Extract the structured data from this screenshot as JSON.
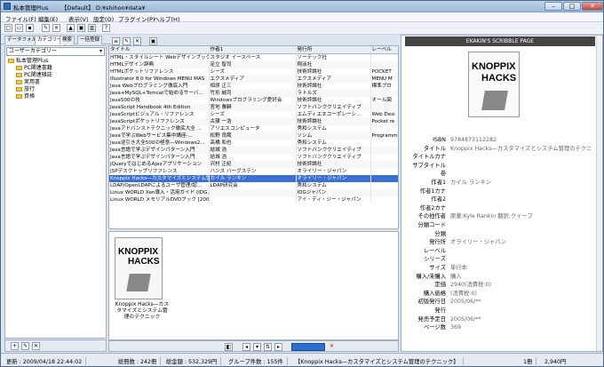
{
  "window": {
    "title": "私本管理Plus",
    "doc": "【Default】 D:¥shihon¥data¥",
    "min": "–",
    "max": "□",
    "close": "✕"
  },
  "menu": [
    "ファイル(F)",
    "編集(E)",
    "表示(V)",
    "設定(O)",
    "プラグイン(P)",
    "ヘルプ(H)"
  ],
  "tabs": [
    "データフォルダ",
    "カテゴリー",
    "検索",
    "一括登録"
  ],
  "category_select": "ユーザーカテゴリー",
  "tree": [
    "私本管理Plus",
    "PC関連書籍",
    "PC関連雑誌",
    "実用書",
    "旅行",
    "資格"
  ],
  "grid": {
    "columns": [
      "タイトル",
      "作者1",
      "発行所",
      "レーベル"
    ],
    "rows": [
      [
        "HTML・スタイルシート Webデザインブック",
        "スタジオ イースペース",
        "ソーテック社",
        ""
      ],
      [
        "HTMLデザイン辞典",
        "足立 智司",
        "翔泳社",
        ""
      ],
      [
        "HTMLポケットリファレンス",
        "シーズ",
        "技術評論社",
        "POCKET"
      ],
      [
        "Illustrator 8.0 for Windows MENU MAS",
        "エクスメディア",
        "エクスメディア",
        "MENU M"
      ],
      [
        "Java Webプログラミング徹底入門",
        "相原 正三",
        "技術評論社",
        "標準プロ"
      ],
      [
        "Java+MySQL+Tomcatで始めるサーバ...",
        "竹形 誠司",
        "ラトルズ",
        ""
      ],
      [
        "Java500の技",
        "Windowsプログラミング愛好会",
        "技術評論社",
        "オール図"
      ],
      [
        "JavaScript Handbook 4th Edition",
        "宮地 雅嗣",
        "ソフトバンククリエイティブ",
        ""
      ],
      [
        "JavaScriptビジュアル・リファレンス",
        "シーズ",
        "エムディエヌコーポレーシ...",
        "Web Desi"
      ],
      [
        "JavaScriptポケットリファレンス",
        "古籏 一浩",
        "技術評論社",
        "Pocket re"
      ],
      [
        "Javaアドバンストテクニック徹底大全 ...",
        "アリエスコンピュータ",
        "秀和システム",
        ""
      ],
      [
        "Javaで学ぶWebサービス集中講座-...",
        "松野 良蔵",
        "ソシム",
        "Programm"
      ],
      [
        "Java逆引き大全500の極意―Windows2...",
        "高橋 和也",
        "秀和システム",
        ""
      ],
      [
        "Java言語で学ぶデザインパターン入門",
        "結城 浩",
        "ソフトバンククリエイティブ",
        ""
      ],
      [
        "Java言語で学ぶデザインパターン入門",
        "結城 浩",
        "ソフトバンククリエイティブ",
        ""
      ],
      [
        "jQueryではじめるAjaxアプリケーション",
        "沢村 正紀",
        "技術評論社",
        ""
      ],
      [
        "JSPデスクトップリファレンス",
        "ハンス バーグステン",
        "オライリー・ジャパン",
        ""
      ],
      [
        "Knoppix Hacks―カスタマイズとシステム管理のテクニック",
        "カイル ランキン",
        "オライリー・ジャパン",
        ""
      ],
      [
        "LDAP/OpenLDAPによるユーザ管理/認...",
        "LDAP研究会",
        "秀和システム",
        ""
      ],
      [
        "Linux WORLD Xen導入・活用ガイド (IDG...",
        "",
        "IDGジャパン",
        ""
      ],
      [
        "Linux WORLD メモリアルDVDブック [2001-...",
        "",
        "アイ・ディ・ジー・ジャパン",
        ""
      ]
    ],
    "selected_index": 17
  },
  "thumb": {
    "cover_title": "KNOPPIX",
    "cover_sub": "HACKS",
    "caption": "Knoppix Hacks―カスタマイズとシステム管理のテクニック"
  },
  "detail": {
    "header": "EKAKIN'S SCRIBBLE PAGE",
    "cover_title": "KNOPPIX",
    "cover_sub": "HACKS",
    "fields": [
      [
        "ISBN",
        "9784873112282"
      ],
      [
        "タイトル",
        "Knoppix Hacks―カスタマイズとシステム管理のテクニック"
      ],
      [
        "タイトルカナ",
        ""
      ],
      [
        "サブタイトル",
        ""
      ],
      [
        "巻",
        ""
      ],
      [
        "作者1",
        "カイル ランキン"
      ],
      [
        "作者1カナ",
        ""
      ],
      [
        "作者2",
        ""
      ],
      [
        "作者2カナ",
        ""
      ],
      [
        "その他作者",
        "原著:Kyle Rankin 翻訳:クイープ"
      ],
      [
        "分類コード",
        ""
      ],
      [
        "分類",
        ""
      ],
      [
        "発行所",
        "オライリー・ジャパン"
      ],
      [
        "レーベル",
        ""
      ],
      [
        "シリーズ",
        ""
      ],
      [
        "サイズ",
        "単行本"
      ],
      [
        "購入/未購入",
        "購入"
      ],
      [
        "定価",
        "2940(消費税:0)"
      ],
      [
        "購入価格",
        "(消費税:0)"
      ],
      [
        "初版発行日",
        "2005/06/**"
      ],
      [
        "発行",
        ""
      ],
      [
        "発売予定日",
        "2005/06/**"
      ],
      [
        "ページ数",
        "369"
      ]
    ]
  },
  "status": {
    "updated": "更新 : 2009/04/18 22:44:02",
    "count": "総冊数 : 242冊",
    "total": "総金額 : 532,329円",
    "groups": "グループ件数 : 155件",
    "current": "【Knoppix Hacks―カスタマイズとシステム管理のテクニック】",
    "num": "1冊",
    "price": "2,940円"
  }
}
